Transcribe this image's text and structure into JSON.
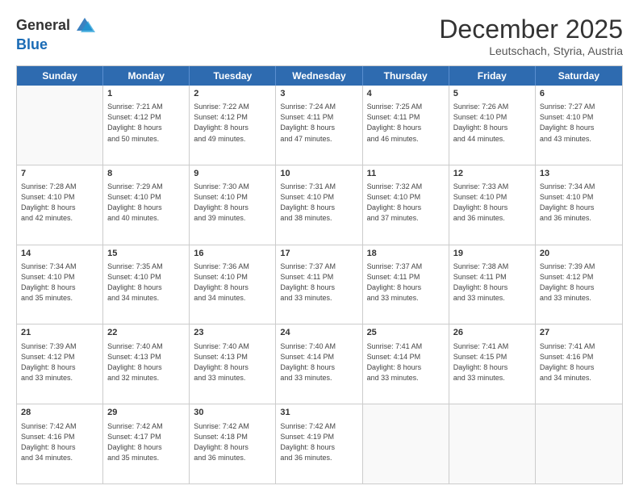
{
  "header": {
    "logo_general": "General",
    "logo_blue": "Blue",
    "month_title": "December 2025",
    "location": "Leutschach, Styria, Austria"
  },
  "days_of_week": [
    "Sunday",
    "Monday",
    "Tuesday",
    "Wednesday",
    "Thursday",
    "Friday",
    "Saturday"
  ],
  "weeks": [
    [
      {
        "day": "",
        "info": ""
      },
      {
        "day": "1",
        "info": "Sunrise: 7:21 AM\nSunset: 4:12 PM\nDaylight: 8 hours\nand 50 minutes."
      },
      {
        "day": "2",
        "info": "Sunrise: 7:22 AM\nSunset: 4:12 PM\nDaylight: 8 hours\nand 49 minutes."
      },
      {
        "day": "3",
        "info": "Sunrise: 7:24 AM\nSunset: 4:11 PM\nDaylight: 8 hours\nand 47 minutes."
      },
      {
        "day": "4",
        "info": "Sunrise: 7:25 AM\nSunset: 4:11 PM\nDaylight: 8 hours\nand 46 minutes."
      },
      {
        "day": "5",
        "info": "Sunrise: 7:26 AM\nSunset: 4:10 PM\nDaylight: 8 hours\nand 44 minutes."
      },
      {
        "day": "6",
        "info": "Sunrise: 7:27 AM\nSunset: 4:10 PM\nDaylight: 8 hours\nand 43 minutes."
      }
    ],
    [
      {
        "day": "7",
        "info": "Sunrise: 7:28 AM\nSunset: 4:10 PM\nDaylight: 8 hours\nand 42 minutes."
      },
      {
        "day": "8",
        "info": "Sunrise: 7:29 AM\nSunset: 4:10 PM\nDaylight: 8 hours\nand 40 minutes."
      },
      {
        "day": "9",
        "info": "Sunrise: 7:30 AM\nSunset: 4:10 PM\nDaylight: 8 hours\nand 39 minutes."
      },
      {
        "day": "10",
        "info": "Sunrise: 7:31 AM\nSunset: 4:10 PM\nDaylight: 8 hours\nand 38 minutes."
      },
      {
        "day": "11",
        "info": "Sunrise: 7:32 AM\nSunset: 4:10 PM\nDaylight: 8 hours\nand 37 minutes."
      },
      {
        "day": "12",
        "info": "Sunrise: 7:33 AM\nSunset: 4:10 PM\nDaylight: 8 hours\nand 36 minutes."
      },
      {
        "day": "13",
        "info": "Sunrise: 7:34 AM\nSunset: 4:10 PM\nDaylight: 8 hours\nand 36 minutes."
      }
    ],
    [
      {
        "day": "14",
        "info": "Sunrise: 7:34 AM\nSunset: 4:10 PM\nDaylight: 8 hours\nand 35 minutes."
      },
      {
        "day": "15",
        "info": "Sunrise: 7:35 AM\nSunset: 4:10 PM\nDaylight: 8 hours\nand 34 minutes."
      },
      {
        "day": "16",
        "info": "Sunrise: 7:36 AM\nSunset: 4:10 PM\nDaylight: 8 hours\nand 34 minutes."
      },
      {
        "day": "17",
        "info": "Sunrise: 7:37 AM\nSunset: 4:11 PM\nDaylight: 8 hours\nand 33 minutes."
      },
      {
        "day": "18",
        "info": "Sunrise: 7:37 AM\nSunset: 4:11 PM\nDaylight: 8 hours\nand 33 minutes."
      },
      {
        "day": "19",
        "info": "Sunrise: 7:38 AM\nSunset: 4:11 PM\nDaylight: 8 hours\nand 33 minutes."
      },
      {
        "day": "20",
        "info": "Sunrise: 7:39 AM\nSunset: 4:12 PM\nDaylight: 8 hours\nand 33 minutes."
      }
    ],
    [
      {
        "day": "21",
        "info": "Sunrise: 7:39 AM\nSunset: 4:12 PM\nDaylight: 8 hours\nand 33 minutes."
      },
      {
        "day": "22",
        "info": "Sunrise: 7:40 AM\nSunset: 4:13 PM\nDaylight: 8 hours\nand 32 minutes."
      },
      {
        "day": "23",
        "info": "Sunrise: 7:40 AM\nSunset: 4:13 PM\nDaylight: 8 hours\nand 33 minutes."
      },
      {
        "day": "24",
        "info": "Sunrise: 7:40 AM\nSunset: 4:14 PM\nDaylight: 8 hours\nand 33 minutes."
      },
      {
        "day": "25",
        "info": "Sunrise: 7:41 AM\nSunset: 4:14 PM\nDaylight: 8 hours\nand 33 minutes."
      },
      {
        "day": "26",
        "info": "Sunrise: 7:41 AM\nSunset: 4:15 PM\nDaylight: 8 hours\nand 33 minutes."
      },
      {
        "day": "27",
        "info": "Sunrise: 7:41 AM\nSunset: 4:16 PM\nDaylight: 8 hours\nand 34 minutes."
      }
    ],
    [
      {
        "day": "28",
        "info": "Sunrise: 7:42 AM\nSunset: 4:16 PM\nDaylight: 8 hours\nand 34 minutes."
      },
      {
        "day": "29",
        "info": "Sunrise: 7:42 AM\nSunset: 4:17 PM\nDaylight: 8 hours\nand 35 minutes."
      },
      {
        "day": "30",
        "info": "Sunrise: 7:42 AM\nSunset: 4:18 PM\nDaylight: 8 hours\nand 36 minutes."
      },
      {
        "day": "31",
        "info": "Sunrise: 7:42 AM\nSunset: 4:19 PM\nDaylight: 8 hours\nand 36 minutes."
      },
      {
        "day": "",
        "info": ""
      },
      {
        "day": "",
        "info": ""
      },
      {
        "day": "",
        "info": ""
      }
    ]
  ]
}
